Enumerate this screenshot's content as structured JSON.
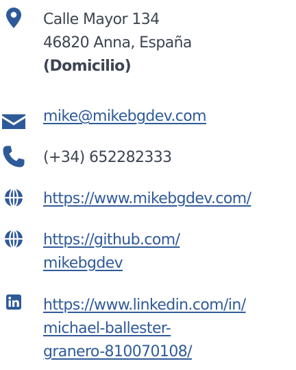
{
  "colors": {
    "icon": "#2f5a99",
    "text": "#3d4451",
    "link": "#2f5a99"
  },
  "contacts": {
    "address": {
      "icon": "map-marker-icon",
      "line1": "Calle Mayor 134",
      "line2": "46820 Anna, España",
      "note": "(Domicilio)"
    },
    "email": {
      "icon": "envelope-icon",
      "value": "mike@mikebgdev.com"
    },
    "phone": {
      "icon": "phone-icon",
      "value": "(+34) 652282333"
    },
    "website": {
      "icon": "globe-icon",
      "value": "https://www.mikebgdev.com/"
    },
    "github": {
      "icon": "globe-icon",
      "line1": "https://github.com/",
      "line2": "mikebgdev"
    },
    "linkedin": {
      "icon": "linkedin-icon",
      "line1": "https://www.linkedin.com/in/",
      "line2": "michael-ballester-",
      "line3": "granero-810070108/"
    }
  }
}
